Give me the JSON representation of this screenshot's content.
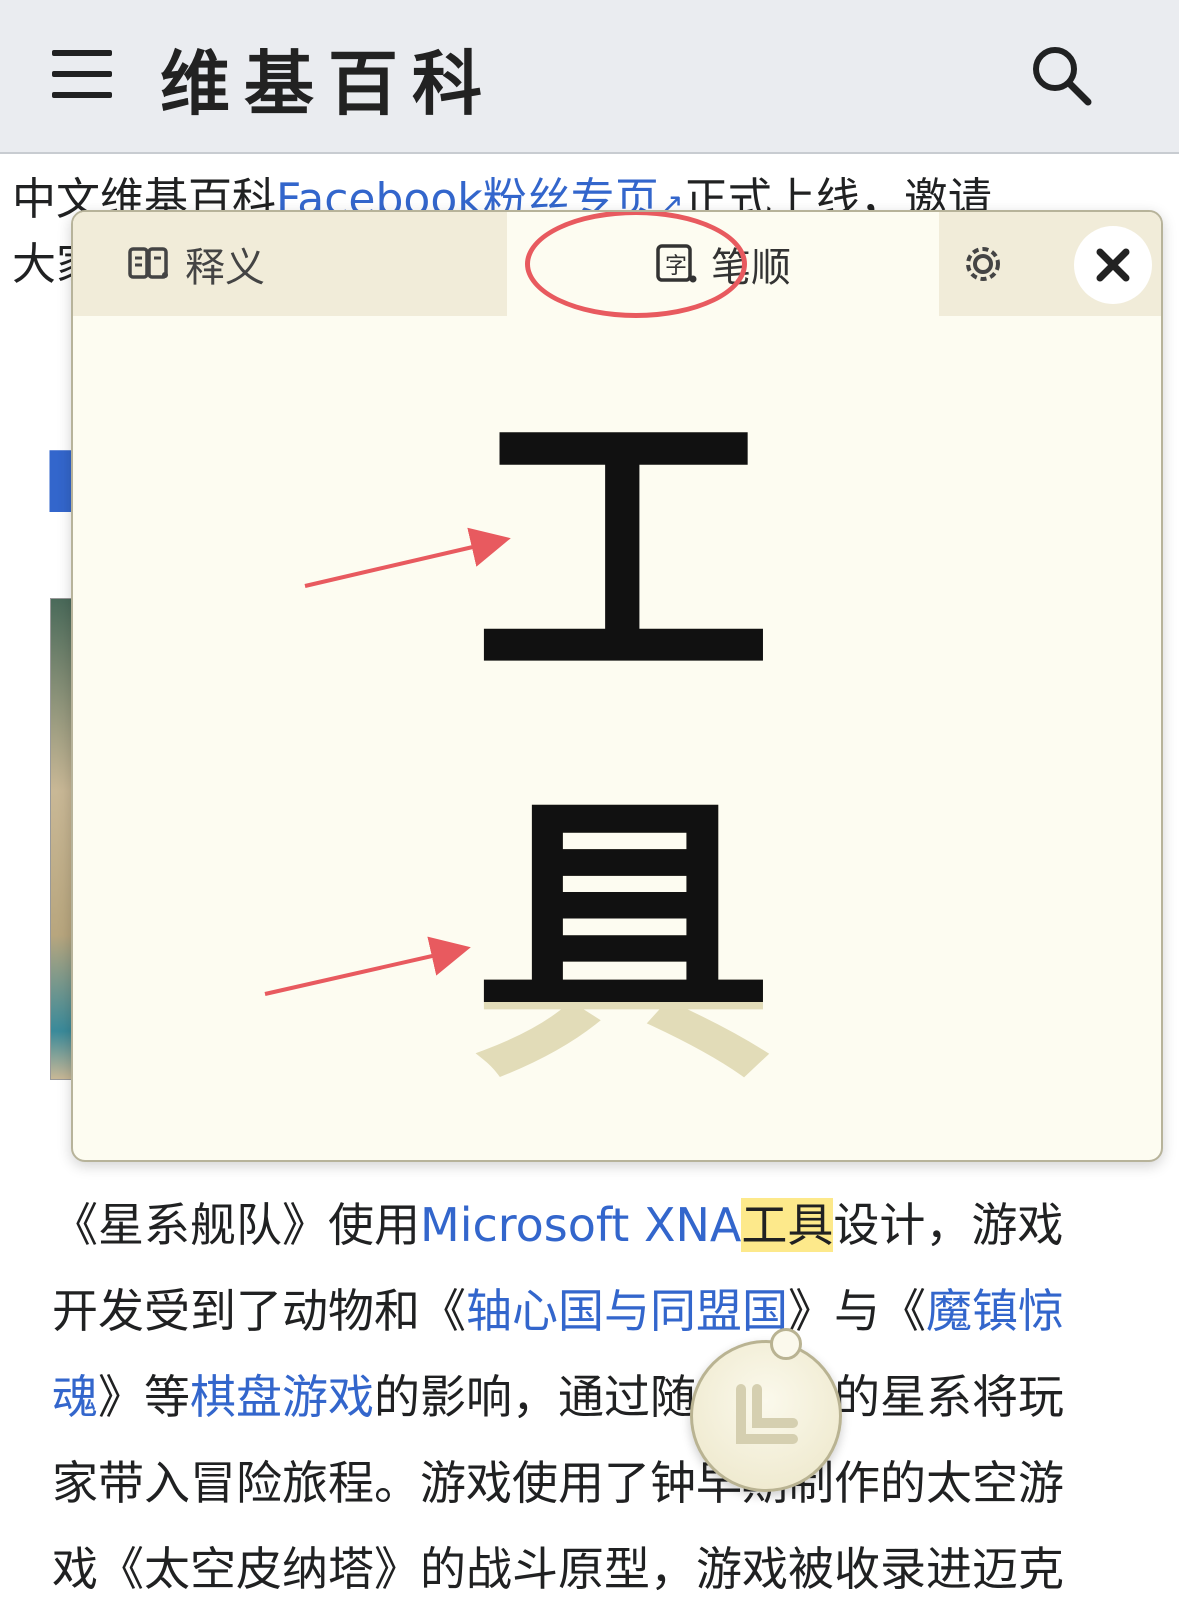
{
  "header": {
    "title": "维基百科"
  },
  "notice": {
    "prefix": "中文维基百科",
    "link": "Facebook粉丝专页",
    "ext_glyph": "↗",
    "suffix": "正式上线，邀请",
    "line2": "大家"
  },
  "popup": {
    "tab_definition": "释义",
    "tab_stroke_order": "笔顺",
    "char1": "工",
    "char2": "具"
  },
  "article": {
    "line1_a": "《星系舰队》使用",
    "line1_link": "Microsoft XNA",
    "line1_hl": "工具",
    "line1_b": "设计，游戏",
    "line2_a": "开发受到了动物和《",
    "line2_link": "轴心国与同盟国",
    "line2_b": "》与《",
    "line2_link2": "魔镇惊",
    "line3_link": "魂",
    "line3_a": "》等",
    "line3_link2": "棋盘游戏",
    "line3_b": "的影响，通过随机生成的星系将玩",
    "line4": "家带入冒险旅程。游戏使用了钟早期制作的太空游",
    "line5": "戏《太空皮纳塔》的战斗原型，游戏被收录进迈克"
  },
  "colors": {
    "link": "#3366cc",
    "highlight": "#fde98b",
    "annotation_red": "#e85a5f",
    "popup_bg": "#fdfcf1"
  }
}
